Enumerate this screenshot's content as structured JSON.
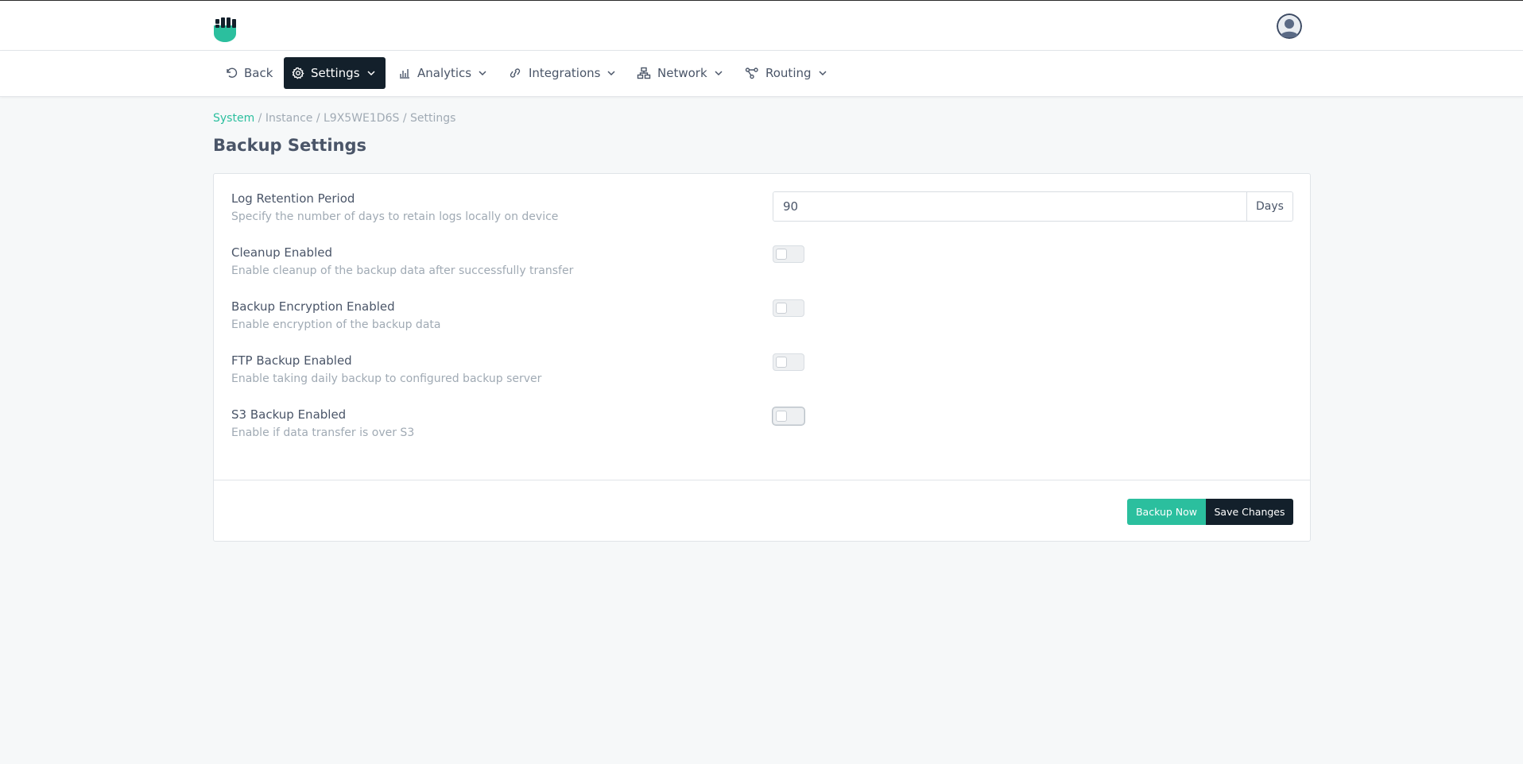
{
  "header": {
    "logo_icon": "brand-shield-logo",
    "avatar_icon": "user-avatar-icon",
    "accent_color": "#2bbf9e",
    "dark_color": "#13202b"
  },
  "nav": {
    "back": "Back",
    "settings": "Settings",
    "analytics": "Analytics",
    "integrations": "Integrations",
    "network": "Network",
    "routing": "Routing"
  },
  "breadcrumb": {
    "root": "System",
    "rest": " / Instance / L9X5WE1D6S / Settings"
  },
  "page": {
    "title": "Backup Settings"
  },
  "settings": {
    "retention": {
      "title": "Log Retention Period",
      "desc": "Specify the number of days to retain logs locally on device",
      "value": "90",
      "unit": "Days"
    },
    "cleanup": {
      "title": "Cleanup Enabled",
      "desc": "Enable cleanup of the backup data after successfully transfer",
      "enabled": false
    },
    "encryption": {
      "title": "Backup Encryption Enabled",
      "desc": "Enable encryption of the backup data",
      "enabled": false
    },
    "ftp": {
      "title": "FTP Backup Enabled",
      "desc": "Enable taking daily backup to configured backup server",
      "enabled": false
    },
    "s3": {
      "title": "S3 Backup Enabled",
      "desc": "Enable if data transfer is over S3",
      "enabled": false
    }
  },
  "actions": {
    "backup_now": "Backup Now",
    "save_changes": "Save Changes"
  }
}
